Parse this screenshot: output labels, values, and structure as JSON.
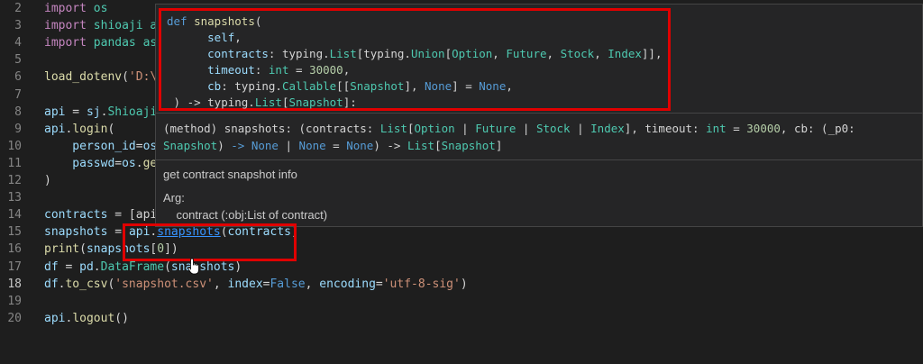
{
  "editor": {
    "lines": [
      {
        "n": "2",
        "tokens": [
          [
            "kw",
            "import "
          ],
          [
            "mod",
            "os"
          ]
        ]
      },
      {
        "n": "3",
        "tokens": [
          [
            "kw",
            "import "
          ],
          [
            "mod",
            "shioaji a"
          ]
        ]
      },
      {
        "n": "4",
        "tokens": [
          [
            "kw",
            "import "
          ],
          [
            "mod",
            "pandas as"
          ]
        ]
      },
      {
        "n": "5",
        "tokens": []
      },
      {
        "n": "6",
        "tokens": [
          [
            "fn",
            "load_dotenv"
          ],
          [
            "plain",
            "("
          ],
          [
            "str",
            "'D:\\"
          ]
        ]
      },
      {
        "n": "7",
        "tokens": []
      },
      {
        "n": "8",
        "tokens": [
          [
            "var",
            "api"
          ],
          [
            "plain",
            " = "
          ],
          [
            "var",
            "sj"
          ],
          [
            "plain",
            "."
          ],
          [
            "mod",
            "Shioaji"
          ]
        ]
      },
      {
        "n": "9",
        "tokens": [
          [
            "var",
            "api"
          ],
          [
            "plain",
            "."
          ],
          [
            "fn",
            "login"
          ],
          [
            "plain",
            "("
          ]
        ]
      },
      {
        "n": "10",
        "tokens": [
          [
            "param",
            "    person_id"
          ],
          [
            "plain",
            "="
          ],
          [
            "var",
            "os"
          ]
        ]
      },
      {
        "n": "11",
        "tokens": [
          [
            "param",
            "    passwd"
          ],
          [
            "plain",
            "="
          ],
          [
            "var",
            "os"
          ],
          [
            "plain",
            "."
          ],
          [
            "fn",
            "ge"
          ]
        ]
      },
      {
        "n": "12",
        "tokens": [
          [
            "plain",
            ")"
          ]
        ]
      },
      {
        "n": "13",
        "tokens": []
      },
      {
        "n": "14",
        "tokens": [
          [
            "var",
            "contracts"
          ],
          [
            "plain",
            " = [api"
          ]
        ]
      },
      {
        "n": "15",
        "tokens": [
          [
            "var",
            "snapshots"
          ],
          [
            "plain",
            " = "
          ],
          [
            "var",
            "api"
          ],
          [
            "plain",
            "."
          ],
          [
            "link",
            "snapshots"
          ],
          [
            "plain",
            "("
          ],
          [
            "var",
            "contracts"
          ],
          [
            "plain",
            ")"
          ]
        ]
      },
      {
        "n": "16",
        "tokens": [
          [
            "fn",
            "print"
          ],
          [
            "plain",
            "("
          ],
          [
            "var",
            "snapshots"
          ],
          [
            "plain",
            "["
          ],
          [
            "num",
            "0"
          ],
          [
            "plain",
            "])"
          ]
        ]
      },
      {
        "n": "17",
        "tokens": [
          [
            "var",
            "df"
          ],
          [
            "plain",
            " = "
          ],
          [
            "var",
            "pd"
          ],
          [
            "plain",
            "."
          ],
          [
            "mod",
            "DataFrame"
          ],
          [
            "plain",
            "("
          ],
          [
            "var",
            "snapshots"
          ],
          [
            "plain",
            ")"
          ]
        ]
      },
      {
        "n": "18",
        "tokens": [
          [
            "var",
            "df"
          ],
          [
            "plain",
            "."
          ],
          [
            "fn",
            "to_csv"
          ],
          [
            "plain",
            "("
          ],
          [
            "str",
            "'snapshot.csv'"
          ],
          [
            "plain",
            ", "
          ],
          [
            "param",
            "index"
          ],
          [
            "plain",
            "="
          ],
          [
            "bool",
            "False"
          ],
          [
            "plain",
            ", "
          ],
          [
            "param",
            "encoding"
          ],
          [
            "plain",
            "="
          ],
          [
            "str",
            "'utf-8-sig'"
          ],
          [
            "plain",
            ")"
          ]
        ]
      },
      {
        "n": "19",
        "tokens": []
      },
      {
        "n": "20",
        "tokens": [
          [
            "var",
            "api"
          ],
          [
            "plain",
            "."
          ],
          [
            "fn",
            "logout"
          ],
          [
            "plain",
            "()"
          ]
        ]
      }
    ],
    "active_line": "18"
  },
  "hover": {
    "signature": [
      [
        [
          "sig-def",
          "def "
        ],
        [
          "sig-fn",
          "snapshots"
        ],
        [
          "plain",
          "("
        ]
      ],
      [
        [
          "plain",
          "      "
        ],
        [
          "sig-param",
          "self"
        ],
        [
          "plain",
          ","
        ]
      ],
      [
        [
          "plain",
          "      "
        ],
        [
          "sig-param",
          "contracts"
        ],
        [
          "plain",
          ": typing."
        ],
        [
          "sig-type",
          "List"
        ],
        [
          "plain",
          "[typing."
        ],
        [
          "sig-type",
          "Union"
        ],
        [
          "plain",
          "["
        ],
        [
          "sig-type",
          "Option"
        ],
        [
          "plain",
          ", "
        ],
        [
          "sig-type",
          "Future"
        ],
        [
          "plain",
          ", "
        ],
        [
          "sig-type",
          "Stock"
        ],
        [
          "plain",
          ", "
        ],
        [
          "sig-type",
          "Index"
        ],
        [
          "plain",
          "]],"
        ]
      ],
      [
        [
          "plain",
          "      "
        ],
        [
          "sig-param",
          "timeout"
        ],
        [
          "plain",
          ": "
        ],
        [
          "sig-type",
          "int"
        ],
        [
          "plain",
          " = "
        ],
        [
          "sig-num",
          "30000"
        ],
        [
          "plain",
          ","
        ]
      ],
      [
        [
          "plain",
          "      "
        ],
        [
          "sig-param",
          "cb"
        ],
        [
          "plain",
          ": typing."
        ],
        [
          "sig-type",
          "Callable"
        ],
        [
          "plain",
          "[["
        ],
        [
          "sig-type",
          "Snapshot"
        ],
        [
          "plain",
          "], "
        ],
        [
          "sig-none",
          "None"
        ],
        [
          "plain",
          "] = "
        ],
        [
          "sig-none",
          "None"
        ],
        [
          "plain",
          ","
        ]
      ],
      [
        [
          "plain",
          " ) -> typing."
        ],
        [
          "sig-type",
          "List"
        ],
        [
          "plain",
          "["
        ],
        [
          "sig-type",
          "Snapshot"
        ],
        [
          "plain",
          "]:"
        ]
      ]
    ],
    "method_line1": [
      [
        "plain",
        "(method) snapshots: (contracts: "
      ],
      [
        "sig-type",
        "List"
      ],
      [
        "plain",
        "["
      ],
      [
        "sig-type",
        "Option"
      ],
      [
        "plain",
        " | "
      ],
      [
        "sig-type",
        "Future"
      ],
      [
        "plain",
        " | "
      ],
      [
        "sig-type",
        "Stock"
      ],
      [
        "plain",
        " | "
      ],
      [
        "sig-type",
        "Index"
      ],
      [
        "plain",
        "], timeout: "
      ],
      [
        "sig-type",
        "int"
      ],
      [
        "plain",
        " = "
      ],
      [
        "sig-num",
        "30000"
      ],
      [
        "plain",
        ", cb: (_p0:"
      ]
    ],
    "method_line2": [
      [
        "sig-type",
        "Snapshot"
      ],
      [
        "plain",
        ") "
      ],
      [
        "sig-none",
        "-> None"
      ],
      [
        "plain",
        " | "
      ],
      [
        "sig-none",
        "None"
      ],
      [
        "plain",
        " = "
      ],
      [
        "sig-none",
        "None"
      ],
      [
        "plain",
        ") -> "
      ],
      [
        "sig-type",
        "List"
      ],
      [
        "plain",
        "["
      ],
      [
        "sig-type",
        "Snapshot"
      ],
      [
        "plain",
        "]"
      ]
    ],
    "description": "get contract snapshot info",
    "arg_label": "Arg:",
    "arg_detail": "    contract (:obj:List of contract)"
  },
  "colors": {
    "highlight_box": "#e00000",
    "background": "#1e1e1e",
    "popup": "#252526"
  },
  "icons": {
    "cursor": "hand-pointer-icon"
  }
}
